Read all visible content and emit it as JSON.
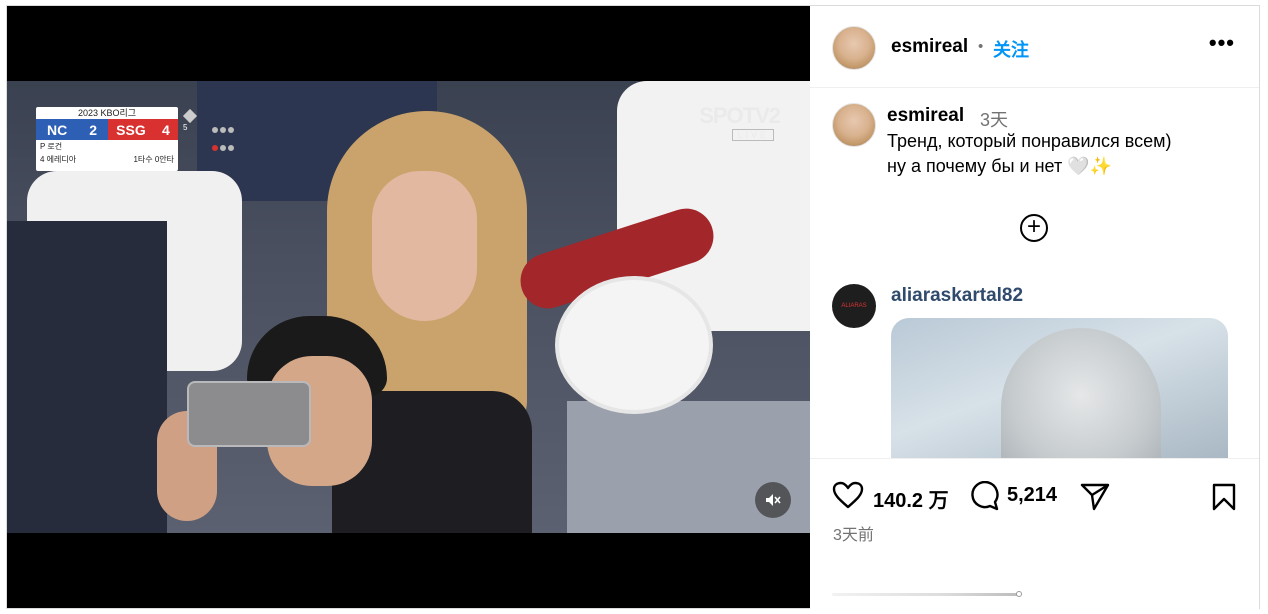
{
  "video": {
    "scoreboard": {
      "title": "2023 KBO리그",
      "team1": "NC",
      "score1": "2",
      "team2": "SSG",
      "score2": "4",
      "pitcher_line": "P 로건",
      "pitcher_extra": "",
      "batter_line": "4 에레디아",
      "batter_stats": "1타수 0안타",
      "inning": "5"
    },
    "broadcaster": "SPOTV2",
    "broadcaster_sub": "LIVE",
    "mute_icon": "mute-icon"
  },
  "post": {
    "username": "esmireal",
    "follow_label": "关注",
    "more_icon": "more-icon",
    "caption_username": "esmireal",
    "caption_time": "3天",
    "caption_line1": "Тренд, который понравился всем)",
    "caption_line2": "ну а почему бы и нет 🤍✨",
    "add_icon": "plus-circle-icon",
    "comment_username": "aliaraskartal82",
    "likes": "140.2 万",
    "comments": "5,214",
    "time_ago": "3天前"
  },
  "colors": {
    "follow": "#0095f6",
    "nc_blue": "#2d5fb5",
    "ssg_red": "#d8312f"
  }
}
